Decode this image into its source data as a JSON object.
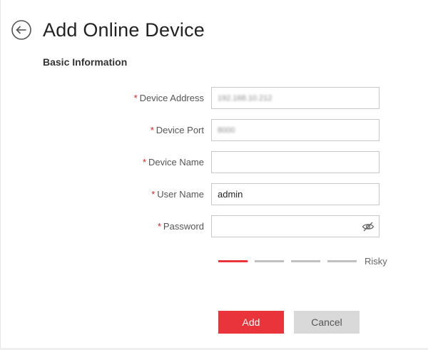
{
  "header": {
    "title": "Add Online Device",
    "back_icon": "back-arrow-circle-icon"
  },
  "section": {
    "title": "Basic Information"
  },
  "form": {
    "required_marker": "*",
    "device_address": {
      "label": "Device Address",
      "value": "192.168.10.212"
    },
    "device_port": {
      "label": "Device Port",
      "value": "8000"
    },
    "device_name": {
      "label": "Device Name",
      "value": ""
    },
    "user_name": {
      "label": "User Name",
      "value": "admin"
    },
    "password": {
      "label": "Password",
      "value": "",
      "toggle_icon": "eye-hidden-icon"
    }
  },
  "password_strength": {
    "label": "Risky",
    "level": 1,
    "total_levels": 4
  },
  "buttons": {
    "add": "Add",
    "cancel": "Cancel"
  },
  "colors": {
    "accent": "#e8343a",
    "required": "#e02020",
    "cancel_bg": "#d9d9d9",
    "inactive_bar": "#c0c0c0"
  }
}
